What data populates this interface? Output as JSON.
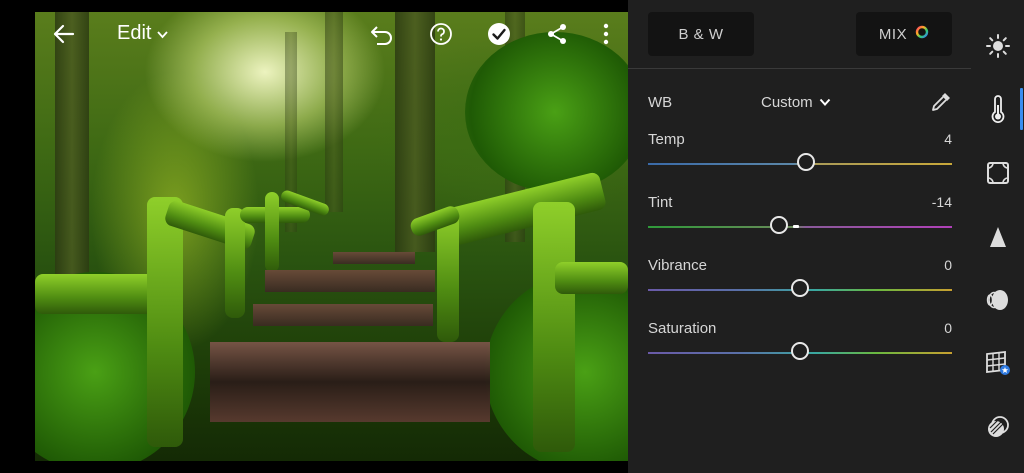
{
  "toolbar": {
    "back_icon": "arrow-left-icon",
    "edit_label": "Edit",
    "icons": [
      "undo-icon",
      "help-icon",
      "check-icon",
      "share-icon",
      "more-vertical-icon"
    ]
  },
  "panel": {
    "bw_label": "B & W",
    "mix_label": "MIX",
    "wb": {
      "label": "WB",
      "selected": "Custom"
    },
    "sliders": [
      {
        "label": "Temp",
        "value": "4",
        "level": 0.52
      },
      {
        "label": "Tint",
        "value": "-14",
        "level": 0.43
      },
      {
        "label": "Vibrance",
        "value": "0",
        "level": 0.5
      },
      {
        "label": "Saturation",
        "value": "0",
        "level": 0.5
      }
    ]
  },
  "rail": {
    "items": [
      "light-icon",
      "color-temperature-icon",
      "effects-icon",
      "detail-icon",
      "optics-icon",
      "geometry-icon",
      "presets-icon"
    ],
    "active_index": 1
  },
  "colors": {
    "accent": "#3a8ef0",
    "panel_bg": "#1f1f1f",
    "button_bg": "#131313"
  }
}
